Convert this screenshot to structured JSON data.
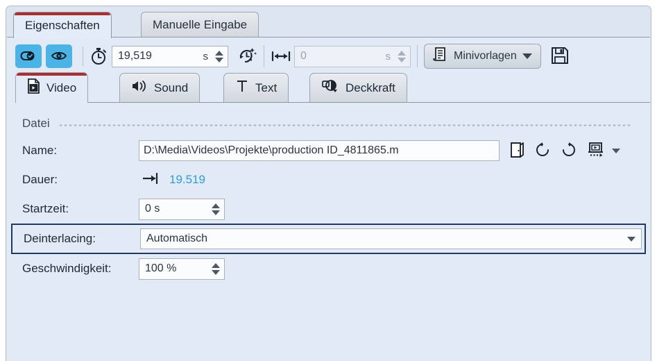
{
  "window": {
    "outer_tabs": [
      {
        "label": "Eigenschaften",
        "active": true
      },
      {
        "label": "Manuelle Eingabe",
        "active": false
      }
    ]
  },
  "toolbar": {
    "toggle_link": {
      "icon": "pill-check-icon",
      "active": true
    },
    "toggle_visibility": {
      "icon": "eye-icon",
      "active": true
    },
    "stopwatch_icon": "stopwatch-icon",
    "duration_field": {
      "value": "19,519",
      "unit": "s"
    },
    "auto_timing_icon": "clock-sparkle-icon",
    "length_icon": "horizontal-arrows-icon",
    "length_field": {
      "value": "0",
      "unit": "s",
      "disabled": true
    },
    "minitemplates_button": {
      "label": "Minivorlagen",
      "icon": "document-list-icon"
    },
    "save_button": {
      "icon": "floppy-disk-icon"
    }
  },
  "inner_tabs": [
    {
      "label": "Video",
      "icon": "film-file-icon",
      "active": true
    },
    {
      "label": "Sound",
      "icon": "speaker-icon",
      "active": false
    },
    {
      "label": "Text",
      "icon": "text-t-icon",
      "active": false
    },
    {
      "label": "Deckkraft",
      "icon": "opacity-icon",
      "active": false
    }
  ],
  "section": {
    "title": "Datei"
  },
  "fields": {
    "name": {
      "label": "Name:",
      "value": "D:\\Media\\Videos\\Projekte\\production ID_4811865.m",
      "browse_icon": "open-folder-icon",
      "rotate_ccw_icon": "rotate-counterclockwise-icon",
      "rotate_cw_icon": "rotate-clockwise-icon",
      "preview_icon": "preview-monitor-icon",
      "preview_caret_icon": "chevron-down-icon"
    },
    "duration": {
      "label": "Dauer:",
      "icon": "arrow-to-bar-icon",
      "value": "19.519"
    },
    "start_time": {
      "label": "Startzeit:",
      "value": "0 s"
    },
    "deinterlacing": {
      "label": "Deinterlacing:",
      "value": "Automatisch",
      "caret_icon": "chevron-down-icon"
    },
    "speed": {
      "label": "Geschwindigkeit:",
      "value": "100 %"
    }
  },
  "colors": {
    "toggle_active": "#4bb4e6",
    "tab_accent": "#b02b2b",
    "selection_border": "#1f3864",
    "duration_text": "#2f9ee0",
    "panel_bg": "#e2eaf6"
  }
}
